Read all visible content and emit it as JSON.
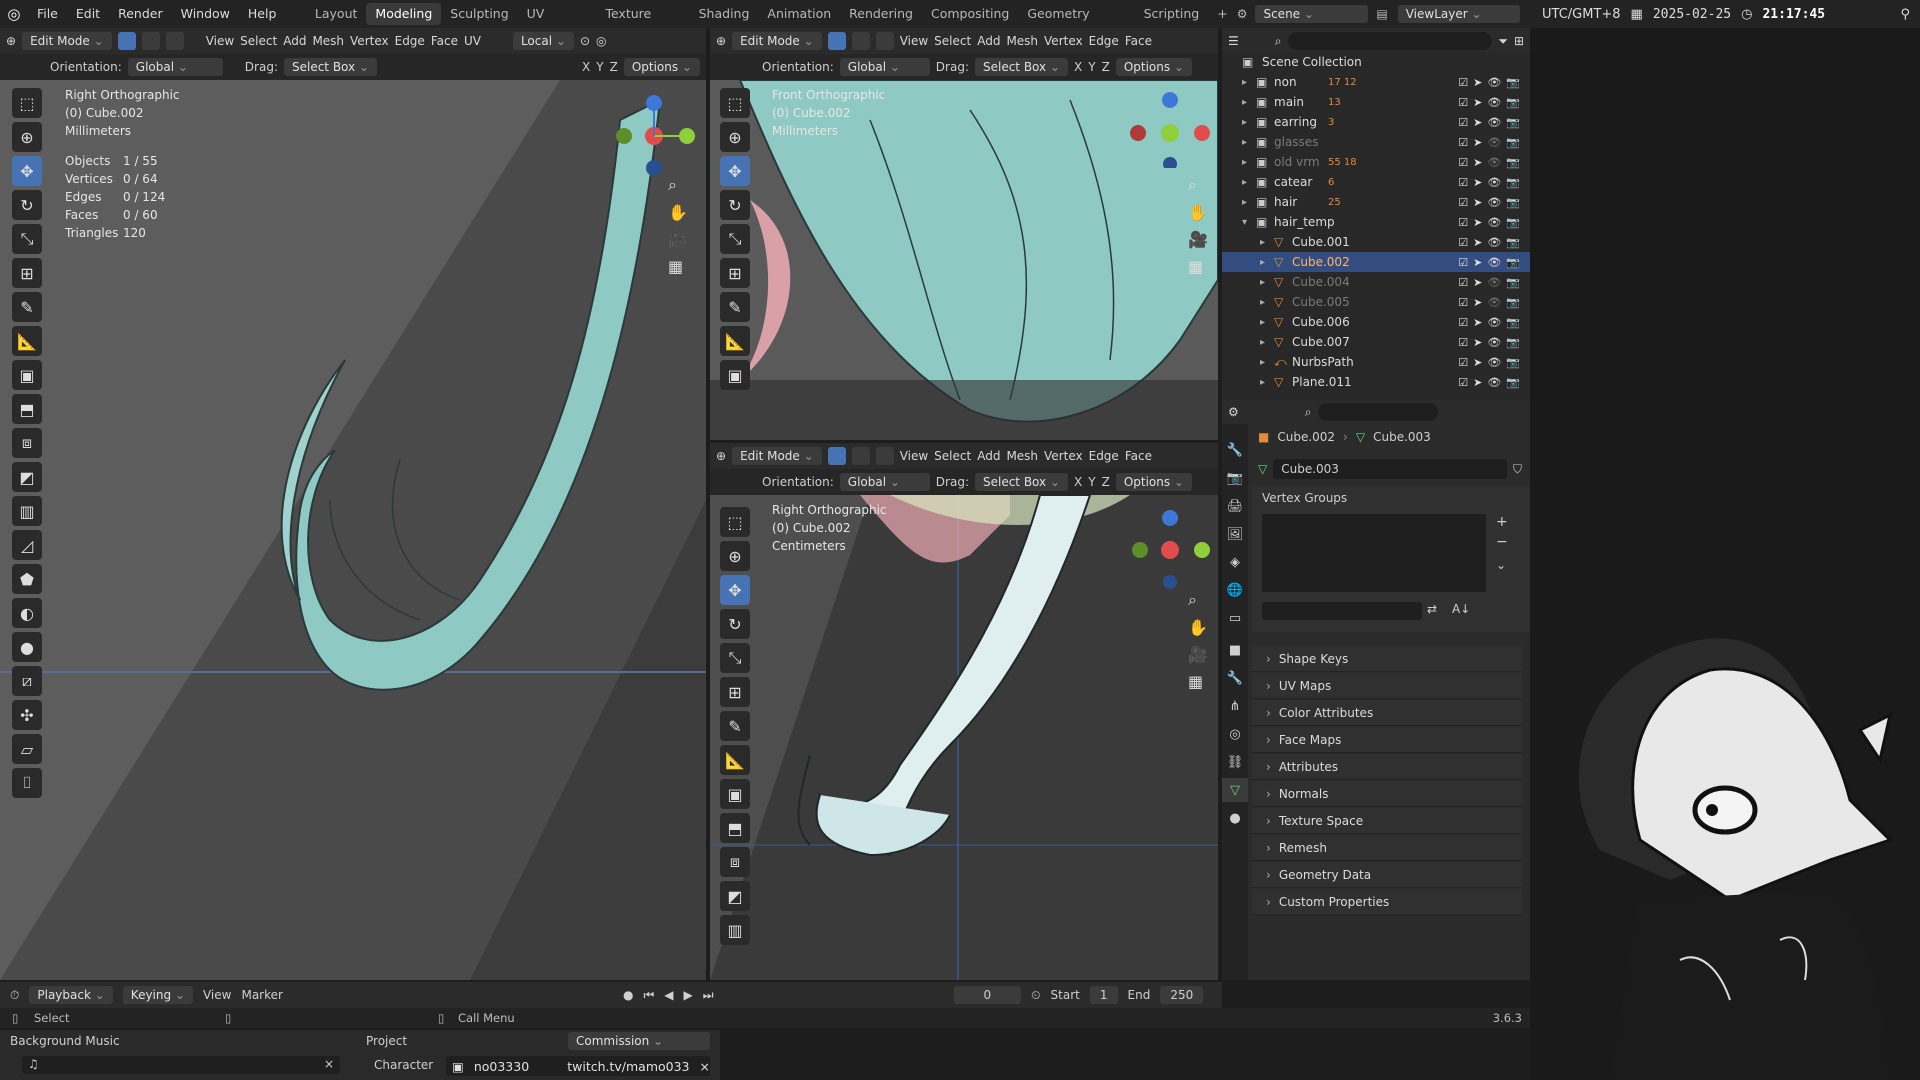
{
  "menu": [
    "File",
    "Edit",
    "Render",
    "Window",
    "Help"
  ],
  "workspaces": [
    "Layout",
    "Modeling",
    "Sculpting",
    "UV Editing",
    "Texture Paint",
    "Shading",
    "Animation",
    "Rendering",
    "Compositing",
    "Geometry Nodes",
    "Scripting"
  ],
  "active_workspace": "Modeling",
  "scene": "Scene",
  "view_layer": "ViewLayer",
  "clock": {
    "tz": "UTC/GMT+8",
    "date": "2025-02-25",
    "time": "21:17:45"
  },
  "vp_left": {
    "mode": "Edit Mode",
    "menus": [
      "View",
      "Select",
      "Add",
      "Mesh",
      "Vertex",
      "Edge",
      "Face",
      "UV"
    ],
    "pivot": "Local",
    "orientation_label": "Orientation:",
    "orientation": "Global",
    "drag_label": "Drag:",
    "drag": "Select Box",
    "options": "Options",
    "view_name": "Right Orthographic",
    "object": "(0) Cube.002",
    "units": "Millimeters",
    "stats": [
      [
        "Objects",
        "1 / 55"
      ],
      [
        "Vertices",
        "0 / 64"
      ],
      [
        "Edges",
        "0 / 124"
      ],
      [
        "Faces",
        "0 / 60"
      ],
      [
        "Triangles",
        "120"
      ]
    ]
  },
  "vp_top": {
    "mode": "Edit Mode",
    "menus": [
      "View",
      "Select",
      "Add",
      "Mesh",
      "Vertex",
      "Edge",
      "Face"
    ],
    "orientation_label": "Orientation:",
    "orientation": "Global",
    "drag_label": "Drag:",
    "drag": "Select Box",
    "options": "Options",
    "view_name": "Front Orthographic",
    "object": "(0) Cube.002",
    "units": "Millimeters"
  },
  "vp_bottom": {
    "mode": "Edit Mode",
    "menus": [
      "View",
      "Select",
      "Add",
      "Mesh",
      "Vertex",
      "Edge",
      "Face"
    ],
    "orientation_label": "Orientation:",
    "orientation": "Global",
    "drag_label": "Drag:",
    "drag": "Select Box",
    "options": "Options",
    "view_name": "Right Orthographic",
    "object": "(0) Cube.002",
    "units": "Centimeters"
  },
  "outliner": {
    "root": "Scene Collection",
    "items": [
      {
        "name": "non",
        "badge": "17  12",
        "depth": 0,
        "type": "collection"
      },
      {
        "name": "main",
        "badge": "13",
        "depth": 0,
        "type": "collection"
      },
      {
        "name": "earring",
        "badge": "3",
        "depth": 0,
        "type": "collection"
      },
      {
        "name": "glasses",
        "badge": "",
        "depth": 0,
        "type": "collection",
        "dim": true
      },
      {
        "name": "old vrm",
        "badge": "55  18",
        "depth": 0,
        "type": "collection",
        "dim": true
      },
      {
        "name": "catear",
        "badge": "6",
        "depth": 0,
        "type": "collection"
      },
      {
        "name": "hair",
        "badge": "25",
        "depth": 0,
        "type": "collection"
      },
      {
        "name": "hair_temp",
        "badge": "",
        "depth": 0,
        "type": "collection",
        "open": true
      },
      {
        "name": "Cube.001",
        "badge": "",
        "depth": 1,
        "type": "mesh"
      },
      {
        "name": "Cube.002",
        "badge": "",
        "depth": 1,
        "type": "mesh",
        "selected": true
      },
      {
        "name": "Cube.004",
        "badge": "",
        "depth": 1,
        "type": "mesh",
        "dim": true
      },
      {
        "name": "Cube.005",
        "badge": "",
        "depth": 1,
        "type": "mesh",
        "dim": true
      },
      {
        "name": "Cube.006",
        "badge": "",
        "depth": 1,
        "type": "mesh"
      },
      {
        "name": "Cube.007",
        "badge": "",
        "depth": 1,
        "type": "mesh"
      },
      {
        "name": "NurbsPath",
        "badge": "",
        "depth": 1,
        "type": "curve"
      },
      {
        "name": "Plane.011",
        "badge": "",
        "depth": 1,
        "type": "mesh"
      }
    ]
  },
  "properties": {
    "breadcrumb_obj": "Cube.002",
    "breadcrumb_data": "Cube.003",
    "data_name": "Cube.003",
    "vertex_groups": "Vertex Groups",
    "panels": [
      "Shape Keys",
      "UV Maps",
      "Color Attributes",
      "Face Maps",
      "Attributes",
      "Normals",
      "Texture Space",
      "Remesh",
      "Geometry Data",
      "Custom Properties"
    ]
  },
  "timeline": {
    "menus": [
      "Playback",
      "Keying",
      "View",
      "Marker"
    ],
    "frame": "0",
    "start_label": "Start",
    "start": "1",
    "end_label": "End",
    "end": "250"
  },
  "status": {
    "left": "Select",
    "mid": "Call Menu",
    "version": "3.6.3"
  },
  "bottom": {
    "bgm_label": "Background Music",
    "project_label": "Project",
    "project_value": "Commission",
    "character_label": "Character",
    "character_value": "no03330",
    "channel": "twitch.tv/mamo033"
  },
  "colors": {
    "accent": "#4772b3",
    "selected_row": "#334d80",
    "mesh_orange": "#e08a3c",
    "hair_teal": "#8fc9c3"
  }
}
